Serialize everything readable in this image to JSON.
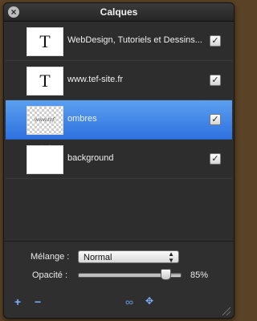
{
  "window": {
    "title": "Calques",
    "close_icon": "×"
  },
  "layers": [
    {
      "thumb_text": "T",
      "name": "WebDesign, Tutoriels et Dessins...",
      "visible": "✓"
    },
    {
      "thumb_text": "T",
      "name": "www.tef-site.fr",
      "visible": "✓"
    },
    {
      "thumb_text": "www.tef-site.fr",
      "name": "ombres",
      "visible": "✓",
      "selected": true
    },
    {
      "thumb_text": "",
      "name": "background",
      "visible": "✓"
    }
  ],
  "blend": {
    "label": "Mélange :",
    "value": "Normal",
    "arrows": "▲\n▼"
  },
  "opacity": {
    "label": "Opacité :",
    "value": "85%",
    "level": 0.85
  },
  "toolbar": {
    "add_icon": "+",
    "remove_icon": "−",
    "link_icon": "∞",
    "move_icon": "✥"
  },
  "colors": {
    "selection": "#3b7fe8",
    "panel": "#2f2f2f",
    "desktop": "#5a4226"
  }
}
